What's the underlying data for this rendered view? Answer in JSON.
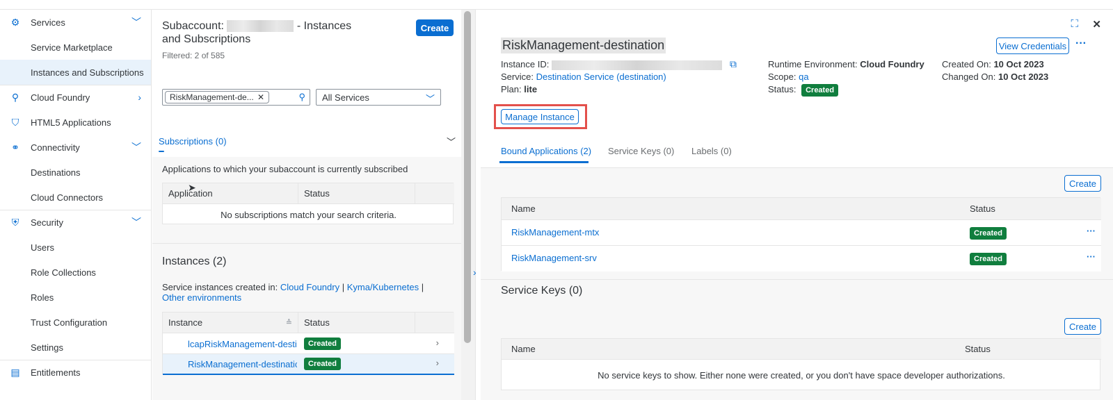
{
  "sidebar": {
    "items": [
      {
        "label": "Services",
        "icon": "services-icon",
        "expandable": "down"
      },
      {
        "label": "Service Marketplace"
      },
      {
        "label": "Instances and Subscriptions",
        "selected": true
      },
      {
        "label": "Cloud Foundry",
        "icon": "cloud-foundry-icon",
        "expandable": "right"
      },
      {
        "label": "HTML5 Applications",
        "icon": "html5-icon"
      },
      {
        "label": "Connectivity",
        "icon": "connectivity-icon",
        "expandable": "down"
      },
      {
        "label": "Destinations"
      },
      {
        "label": "Cloud Connectors"
      },
      {
        "label": "Security",
        "icon": "shield-icon",
        "expandable": "down"
      },
      {
        "label": "Users"
      },
      {
        "label": "Role Collections"
      },
      {
        "label": "Roles"
      },
      {
        "label": "Trust Configuration"
      },
      {
        "label": "Settings"
      },
      {
        "label": "Entitlements",
        "icon": "entitlements-icon"
      }
    ]
  },
  "middle": {
    "title_prefix": "Subaccount:",
    "title_suffix": "- Instances",
    "title_line2": "and Subscriptions",
    "filtered": "Filtered: 2 of 585",
    "create_label": "Create",
    "search_token": "RiskManagement-de...",
    "services_filter": "All Services",
    "subscriptions_header": "Subscriptions (0)",
    "subscriptions_desc": "Applications to which your subaccount is currently subscribed",
    "subs_columns": [
      "Application",
      "Status"
    ],
    "subs_empty": "No subscriptions match your search criteria.",
    "instances_header": "Instances (2)",
    "instances_desc_prefix": "Service instances created in:",
    "env_links": [
      "Cloud Foundry",
      "Kyma/Kubernetes",
      "Other environments"
    ],
    "env_sep": "|",
    "inst_columns": [
      "Instance",
      "Status"
    ],
    "instances": [
      {
        "name": "lcapRiskManagement-desti",
        "status": "Created"
      },
      {
        "name": "RiskManagement-destinatic",
        "status": "Created"
      }
    ]
  },
  "detail": {
    "title": "RiskManagement-destination",
    "view_credentials": "View Credentials",
    "instance_id_label": "Instance ID:",
    "service_label": "Service:",
    "service_value": "Destination Service (destination)",
    "plan_label": "Plan:",
    "plan_value": "lite",
    "runtime_label": "Runtime Environment:",
    "runtime_value": "Cloud Foundry",
    "scope_label": "Scope:",
    "scope_value": "qa",
    "status_label": "Status:",
    "status_value": "Created",
    "created_on_label": "Created On:",
    "created_on_value": "10 Oct 2023",
    "changed_on_label": "Changed On:",
    "changed_on_value": "10 Oct 2023",
    "manage_instance": "Manage Instance",
    "tabs": [
      "Bound Applications (2)",
      "Service Keys (0)",
      "Labels (0)"
    ],
    "bound_create": "Create",
    "bound_columns": [
      "Name",
      "Status"
    ],
    "bound_apps": [
      {
        "name": "RiskManagement-mtx",
        "status": "Created"
      },
      {
        "name": "RiskManagement-srv",
        "status": "Created"
      }
    ],
    "service_keys_header": "Service Keys (0)",
    "keys_create": "Create",
    "keys_columns": [
      "Name",
      "Status"
    ],
    "keys_empty": "No service keys to show. Either none were created, or you don't have space developer authorizations."
  },
  "colors": {
    "accent": "#0a6ed1",
    "success": "#107e3e",
    "highlight": "#e3504b"
  }
}
